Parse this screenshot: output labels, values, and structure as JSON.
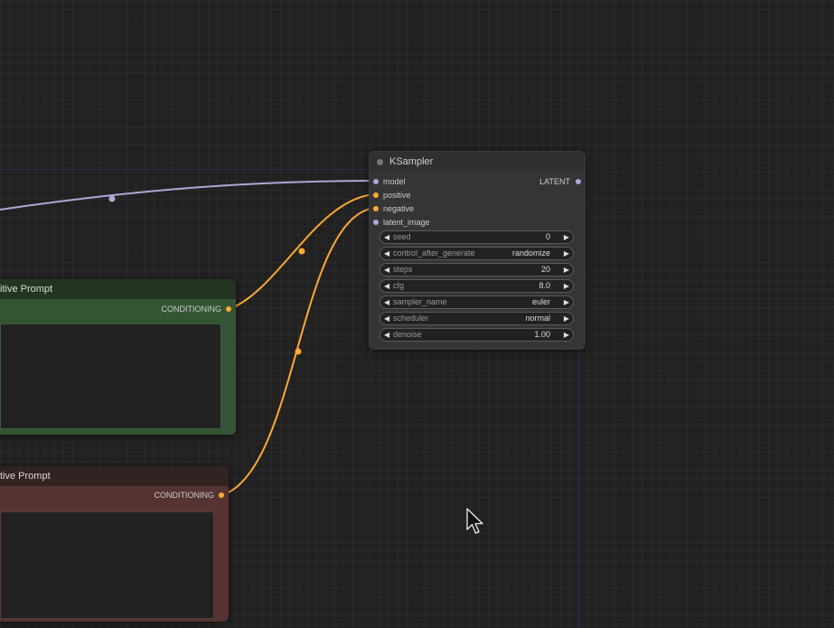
{
  "ksampler": {
    "title": "KSampler",
    "inputs": [
      {
        "label": "model",
        "type": "MODEL",
        "color": "#b0a6d8"
      },
      {
        "label": "positive",
        "type": "CONDITIONING",
        "color": "#ffa931"
      },
      {
        "label": "negative",
        "type": "CONDITIONING",
        "color": "#ffa931"
      },
      {
        "label": "latent_image",
        "type": "LATENT",
        "color": "#b0a6d8"
      }
    ],
    "output": {
      "label": "LATENT",
      "color": "#b0a6d8"
    },
    "widgets": [
      {
        "name": "seed",
        "value": "0"
      },
      {
        "name": "control_after_generate",
        "value": "randomize"
      },
      {
        "name": "steps",
        "value": "20"
      },
      {
        "name": "cfg",
        "value": "8.0"
      },
      {
        "name": "sampler_name",
        "value": "euler"
      },
      {
        "name": "scheduler",
        "value": "normal"
      },
      {
        "name": "denoise",
        "value": "1.00"
      }
    ]
  },
  "positive_node": {
    "title": "itive Prompt",
    "output": {
      "label": "CONDITIONING",
      "color": "#ffa931"
    },
    "text": ""
  },
  "negative_node": {
    "title": "tive Prompt",
    "output": {
      "label": "CONDITIONING",
      "color": "#ffa931"
    },
    "text": ""
  },
  "colors": {
    "canvas": "#212121",
    "conditioning_link": "#ffa931",
    "model_link": "#b0a6d8",
    "positive_node": "#335533",
    "negative_node": "#553333"
  },
  "icons": [
    "mouse-pointer-icon"
  ]
}
